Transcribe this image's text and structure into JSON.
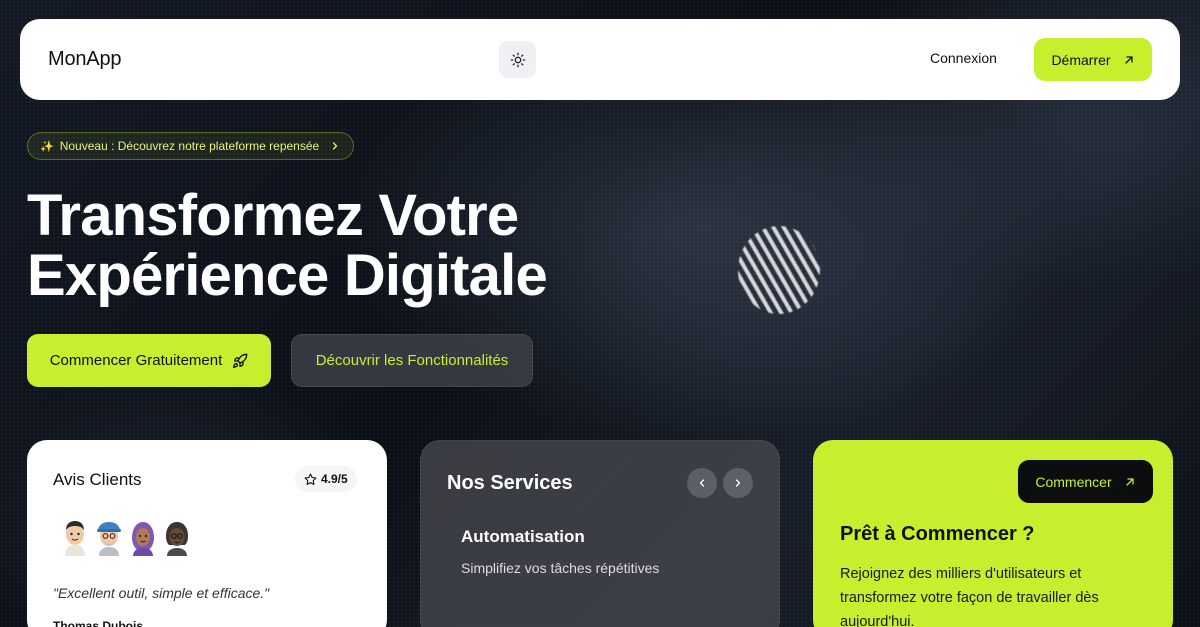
{
  "navbar": {
    "brand": "MonApp",
    "theme_toggle_icon": "sun-icon",
    "login_label": "Connexion",
    "start_label": "Démarrer",
    "start_icon": "arrow-up-right-icon"
  },
  "hero": {
    "badge_icon": "sparkles-icon",
    "badge_text": "Nouveau : Découvrez notre plateforme repensée",
    "badge_arrow_icon": "chevron-right-icon",
    "title_line1": "Transformez Votre",
    "title_line2": "Expérience Digitale",
    "primary_cta": "Commencer Gratuitement",
    "primary_cta_icon": "rocket-icon",
    "secondary_cta": "Découvrir les Fonctionnalités"
  },
  "reviews": {
    "title": "Avis Clients",
    "rating_icon": "star-icon",
    "rating": "4.9/5",
    "avatars": [
      "avatar-1",
      "avatar-2",
      "avatar-3",
      "avatar-4"
    ],
    "quote": "\"Excellent outil, simple et efficace.\"",
    "author": "Thomas Dubois"
  },
  "services": {
    "title": "Nos Services",
    "prev_icon": "chevron-left-icon",
    "next_icon": "chevron-right-icon",
    "item_name": "Automatisation",
    "item_desc": "Simplifiez vos tâches répétitives"
  },
  "cta_card": {
    "button_label": "Commencer",
    "button_icon": "arrow-up-right-icon",
    "title": "Prêt à Commencer ?",
    "text": "Rejoignez des milliers d'utilisateurs et transformez votre façon de travailler dès aujourd'hui."
  },
  "colors": {
    "accent": "#c8ef2e",
    "background": "#0b0f16",
    "card_light": "#ffffff",
    "card_dark": "#46484e"
  }
}
